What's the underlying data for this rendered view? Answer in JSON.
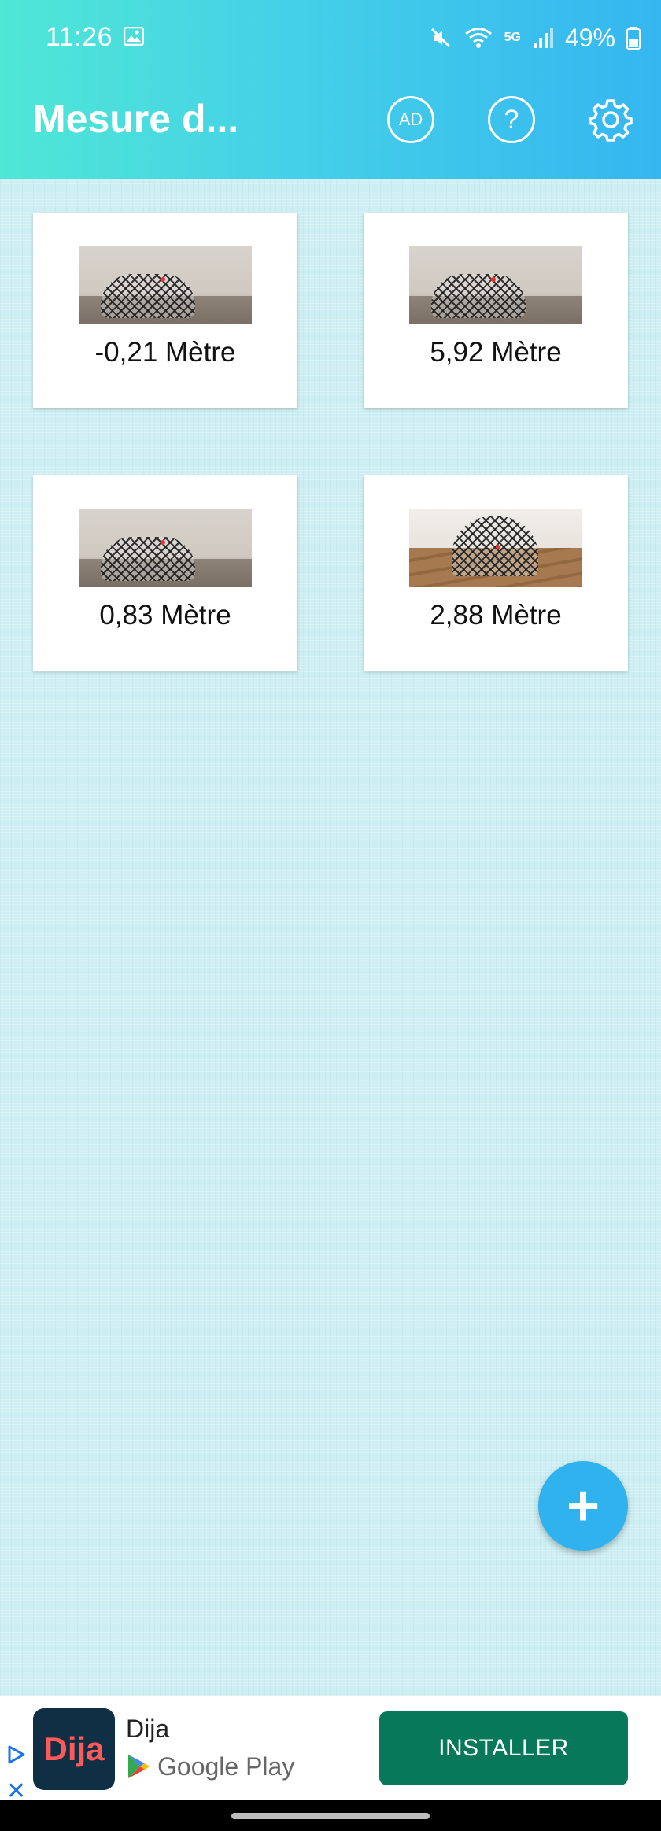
{
  "status_bar": {
    "time": "11:26",
    "network": "5G",
    "battery": "49%"
  },
  "header": {
    "title": "Mesure d...",
    "ad_label": "AD",
    "help_label": "?"
  },
  "measurements": [
    {
      "label": "-0,21 Mètre"
    },
    {
      "label": "5,92 Mètre"
    },
    {
      "label": "0,83 Mètre"
    },
    {
      "label": "2,88 Mètre"
    }
  ],
  "fab": {
    "label": "+"
  },
  "ad": {
    "app_icon_text": "Dija",
    "app_name": "Dija",
    "store": "Google Play",
    "install_label": "INSTALLER"
  },
  "colors": {
    "header_gradient_start": "#4fe7d6",
    "header_gradient_end": "#35b6f0",
    "fab": "#2fb2ee",
    "install_button": "#08785a"
  }
}
